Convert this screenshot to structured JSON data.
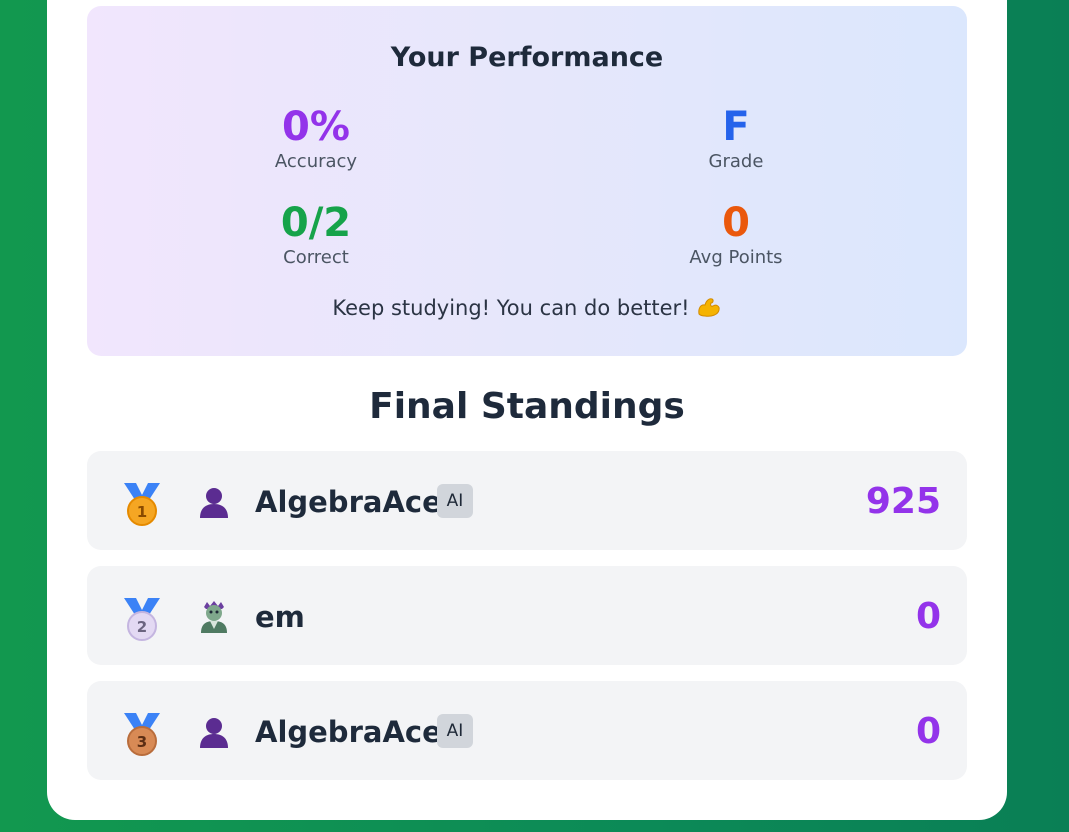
{
  "performance": {
    "title": "Your Performance",
    "accuracy": {
      "value": "0%",
      "label": "Accuracy"
    },
    "grade": {
      "value": "F",
      "label": "Grade"
    },
    "correct": {
      "value": "0/2",
      "label": "Correct"
    },
    "avg_points": {
      "value": "0",
      "label": "Avg Points"
    },
    "message": "Keep studying! You can do better!",
    "message_icon": "flexed-biceps-icon"
  },
  "standings": {
    "title": "Final Standings",
    "rows": [
      {
        "rank": "1",
        "medal": "gold-medal-icon",
        "avatar": "person-silhouette-icon",
        "name": "AlgebraAce",
        "badge": "AI",
        "score": "925"
      },
      {
        "rank": "2",
        "medal": "silver-medal-icon",
        "avatar": "zombie-icon",
        "name": "em",
        "badge": "",
        "score": "0"
      },
      {
        "rank": "3",
        "medal": "bronze-medal-icon",
        "avatar": "person-silhouette-icon",
        "name": "AlgebraAce",
        "badge": "AI",
        "score": "0"
      }
    ]
  },
  "colors": {
    "accuracy": "#9333ea",
    "grade": "#2563eb",
    "correct": "#16a34a",
    "avg_points": "#ea580c",
    "score": "#9333ea",
    "background": "#0f8f50"
  }
}
